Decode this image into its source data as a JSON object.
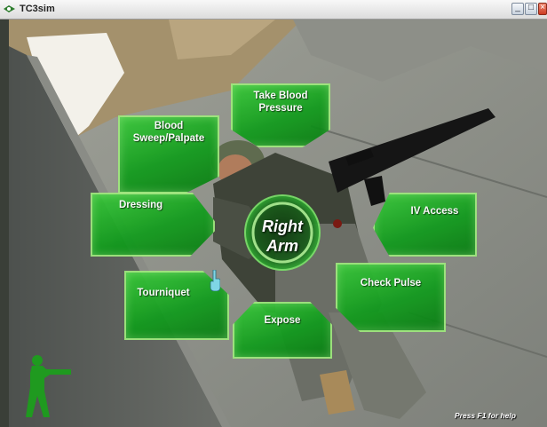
{
  "window": {
    "title": "TC3sim",
    "controls": {
      "minimize": "_",
      "maximize": "□",
      "close": "×"
    }
  },
  "radial_menu": {
    "center_label_line1": "Right",
    "center_label_line2": "Arm",
    "actions": {
      "take_blood_pressure": [
        "Take Blood",
        "Pressure"
      ],
      "blood_sweep_palpate": [
        "Blood",
        "Sweep/Palpate"
      ],
      "dressing": "Dressing",
      "iv_access": "IV Access",
      "tourniquet": "Tourniquet",
      "check_pulse": "Check Pulse",
      "expose": "Expose"
    }
  },
  "footer": {
    "help_hint": "Press F1 for help"
  },
  "colors": {
    "menu_green": "#1fae27",
    "menu_border": "#9fe77e",
    "soldier_icon": "#1f9a1f"
  },
  "icons": [
    "app-icon",
    "hand-cursor-icon",
    "soldier-icon"
  ]
}
